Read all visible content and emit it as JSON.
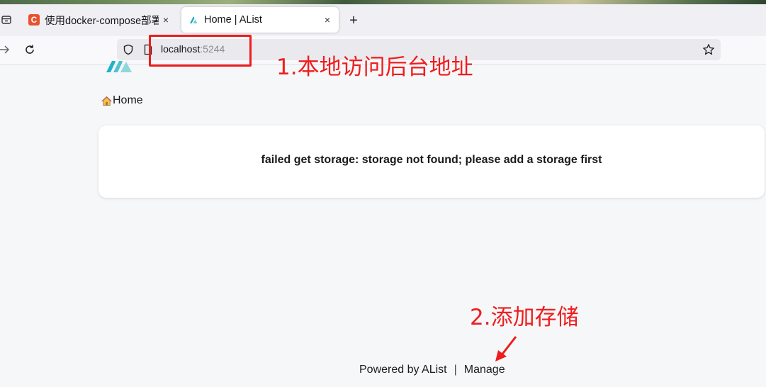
{
  "browser": {
    "tabs": [
      {
        "title": "使用docker-compose部署",
        "favicon": "c-icon",
        "active": false
      },
      {
        "title": "Home | AList",
        "favicon": "alist-icon",
        "active": true
      }
    ],
    "close_glyph": "×",
    "new_tab_glyph": "+",
    "url": {
      "host": "localhost",
      "port": ":5244"
    }
  },
  "page": {
    "breadcrumb_home": "Home",
    "error_message": "failed get storage: storage not found; please add a storage first",
    "footer": {
      "powered_by": "Powered by AList",
      "separator": "|",
      "manage_link": "Manage"
    }
  },
  "annotations": {
    "step1": "1.本地访问后台地址",
    "step2": "2.添加存储",
    "color": "#ee1c1c"
  }
}
